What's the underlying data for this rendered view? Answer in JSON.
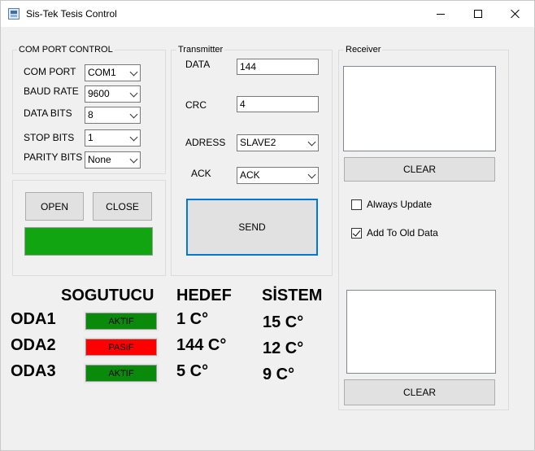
{
  "window": {
    "title": "Sis-Tek Tesis Control"
  },
  "com_port_control": {
    "legend": "COM PORT CONTROL",
    "fields": [
      {
        "label": "COM PORT",
        "value": "COM1"
      },
      {
        "label": "BAUD RATE",
        "value": "9600"
      },
      {
        "label": "DATA BITS",
        "value": "8"
      },
      {
        "label": "STOP BITS",
        "value": "1"
      },
      {
        "label": "PARITY BITS",
        "value": "None"
      }
    ],
    "open_label": "OPEN",
    "close_label": "CLOSE",
    "status_color": "#12a512"
  },
  "transmitter": {
    "legend": "Transmitter",
    "data_label": "DATA",
    "data_value": "144",
    "crc_label": "CRC",
    "crc_value": "4",
    "adress_label": "ADRESS",
    "adress_value": "SLAVE2",
    "ack_label": "ACK",
    "ack_value": "ACK",
    "send_label": "SEND"
  },
  "receiver": {
    "legend": "Receiver",
    "clear_top_label": "CLEAR",
    "always_update_label": "Always Update",
    "always_update_checked": false,
    "add_to_old_label": "Add To Old Data",
    "add_to_old_checked": true,
    "clear_bottom_label": "CLEAR"
  },
  "rooms": {
    "headers": {
      "cooler": "SOGUTUCU",
      "target": "HEDEF",
      "system": "SİSTEM"
    },
    "rows": [
      {
        "name": "ODA1",
        "state": "AKTIF",
        "state_color": "#0a8a0a",
        "target": "1 C°",
        "system": "15 C°"
      },
      {
        "name": "ODA2",
        "state": "PASIF",
        "state_color": "#ff0000",
        "target": "144 C°",
        "system": "12 C°"
      },
      {
        "name": "ODA3",
        "state": "AKTIF",
        "state_color": "#0a8a0a",
        "target": "5 C°",
        "system": "9 C°"
      }
    ]
  }
}
